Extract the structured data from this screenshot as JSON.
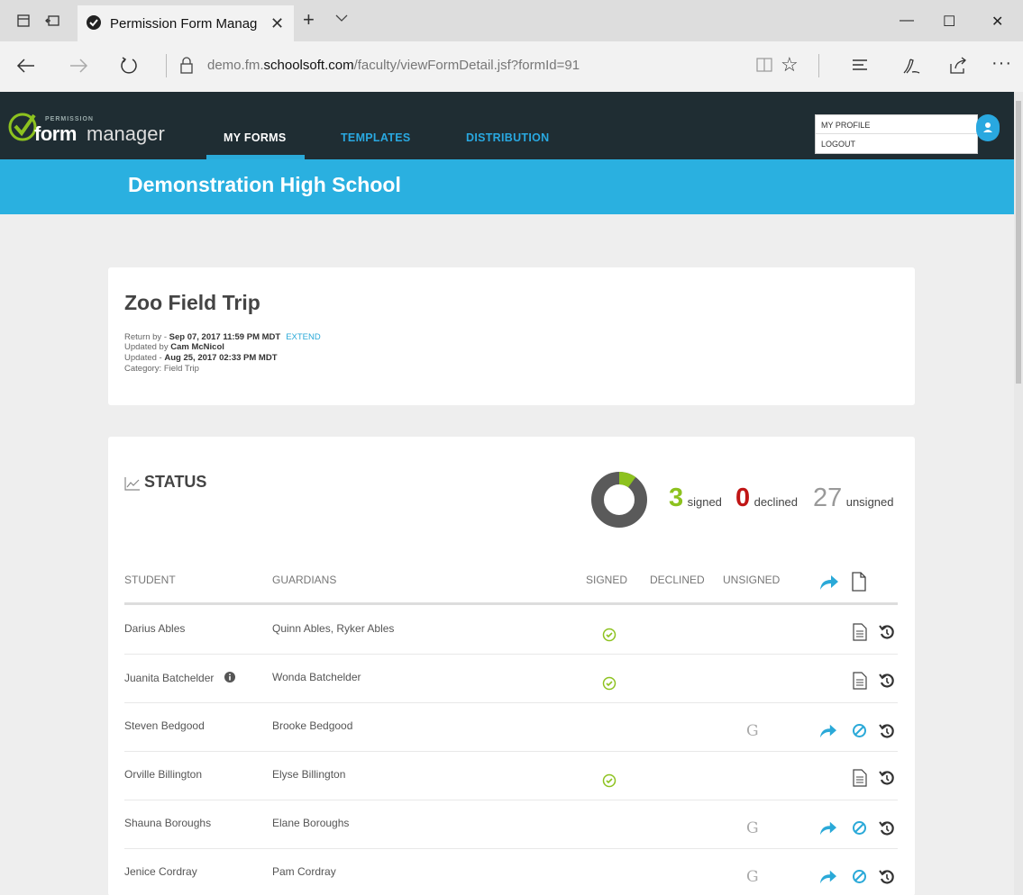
{
  "browser": {
    "tab_title": "Permission Form Manag",
    "url_prefix": "demo.fm.",
    "url_domain": "schoolsoft.com",
    "url_path": "/faculty/viewFormDetail.jsf?formId=91"
  },
  "app": {
    "logo_small": "PERMISSION",
    "logo_form": "form",
    "logo_manager": "manager",
    "nav": {
      "my_forms": "MY FORMS",
      "templates": "TEMPLATES",
      "distribution": "DISTRIBUTION"
    },
    "profile_menu": {
      "my_profile": "MY PROFILE",
      "logout": "LOGOUT"
    },
    "school_name": "Demonstration High School"
  },
  "form": {
    "title": "Zoo Field Trip",
    "return_by_label": "Return by - ",
    "return_by": "Sep 07, 2017 11:59 PM MDT",
    "extend": "EXTEND",
    "updated_by_label": "Updated by ",
    "updated_by": "Cam McNicol",
    "updated_label": "Updated - ",
    "updated": "Aug 25, 2017 02:33 PM MDT",
    "category": "Category: Field Trip"
  },
  "status": {
    "title": "STATUS",
    "signed_count": "3",
    "signed_label": "signed",
    "declined_count": "0",
    "declined_label": "declined",
    "unsigned_count": "27",
    "unsigned_label": "unsigned",
    "signed_fraction": 0.1,
    "colors": {
      "signed": "#8dc21f",
      "declined": "#c01515",
      "unsigned": "#999999",
      "donut_rest": "#5a5a5a",
      "accent": "#2aa9d8"
    }
  },
  "table": {
    "headers": {
      "student": "STUDENT",
      "guardians": "GUARDIANS",
      "signed": "SIGNED",
      "declined": "DECLINED",
      "unsigned": "UNSIGNED"
    },
    "unsigned_marker": "G",
    "rows": [
      {
        "student": "Darius Ables",
        "guardians": "Quinn Ables, Ryker Ables",
        "state": "signed"
      },
      {
        "student": "Juanita Batchelder",
        "guardians": "Wonda Batchelder",
        "state": "signed"
      },
      {
        "student": "Steven Bedgood",
        "guardians": "Brooke Bedgood",
        "state": "unsigned"
      },
      {
        "student": "Orville Billington",
        "guardians": "Elyse Billington",
        "state": "signed"
      },
      {
        "student": "Shauna Boroughs",
        "guardians": "Elane Boroughs",
        "state": "unsigned"
      },
      {
        "student": "Jenice Cordray",
        "guardians": "Pam Cordray",
        "state": "unsigned"
      }
    ]
  }
}
